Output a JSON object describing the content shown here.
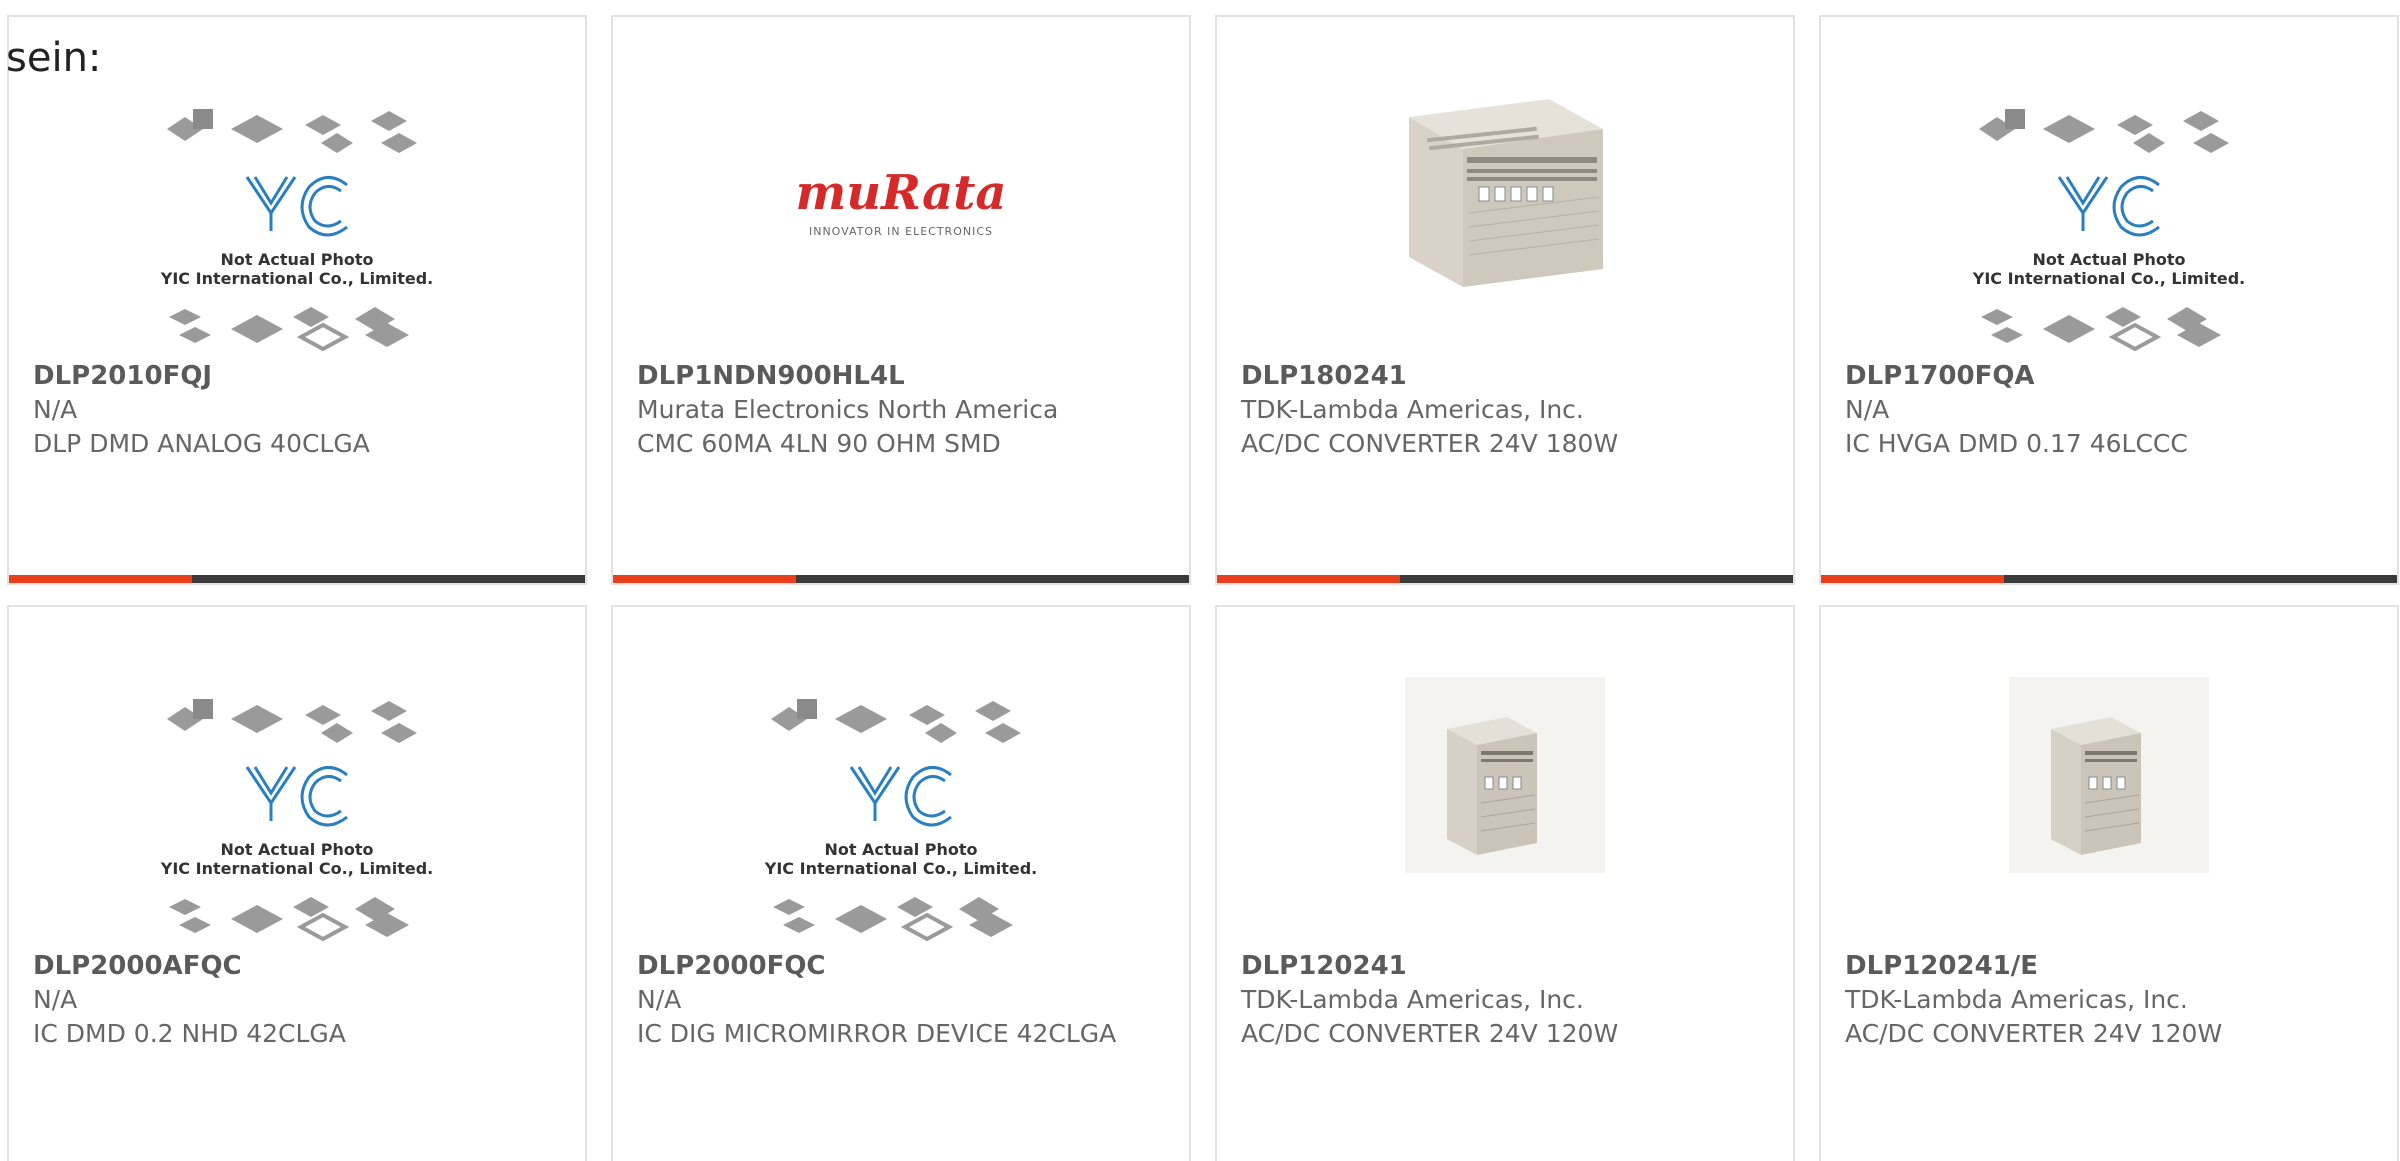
{
  "intro_text": "sein:",
  "colors": {
    "accent": "#e8401c",
    "bar_dark": "#3a3a3a",
    "border": "#e2e2e2",
    "murata_red": "#d42a2a",
    "yic_blue": "#2a7fc0"
  },
  "products": [
    {
      "part": "DLP2010FQJ",
      "manufacturer": "N/A",
      "description": "DLP DMD ANALOG 40CLGA",
      "image": "yic-placeholder",
      "placeholder_line1": "Not Actual Photo",
      "placeholder_line2": "YIC International Co., Limited."
    },
    {
      "part": "DLP1NDN900HL4L",
      "manufacturer": "Murata Electronics North America",
      "description": "CMC 60MA 4LN 90 OHM SMD",
      "image": "murata-logo",
      "logo_text": "muRata",
      "logo_tagline": "INNOVATOR IN ELECTRONICS"
    },
    {
      "part": "DLP180241",
      "manufacturer": "TDK-Lambda Americas, Inc.",
      "description": "AC/DC CONVERTER 24V 180W",
      "image": "power-supply-large"
    },
    {
      "part": "DLP1700FQA",
      "manufacturer": "N/A",
      "description": "IC HVGA DMD 0.17 46LCCC",
      "image": "yic-placeholder",
      "placeholder_line1": "Not Actual Photo",
      "placeholder_line2": "YIC International Co., Limited."
    },
    {
      "part": "DLP2000AFQC",
      "manufacturer": "N/A",
      "description": "IC DMD 0.2 NHD 42CLGA",
      "image": "yic-placeholder",
      "placeholder_line1": "Not Actual Photo",
      "placeholder_line2": "YIC International Co., Limited."
    },
    {
      "part": "DLP2000FQC",
      "manufacturer": "N/A",
      "description": "IC DIG MICROMIRROR DEVICE 42CLGA",
      "image": "yic-placeholder",
      "placeholder_line1": "Not Actual Photo",
      "placeholder_line2": "YIC International Co., Limited."
    },
    {
      "part": "DLP120241",
      "manufacturer": "TDK-Lambda Americas, Inc.",
      "description": "AC/DC CONVERTER 24V 120W",
      "image": "power-supply-small"
    },
    {
      "part": "DLP120241/E",
      "manufacturer": "TDK-Lambda Americas, Inc.",
      "description": "AC/DC CONVERTER 24V 120W",
      "image": "power-supply-small"
    }
  ]
}
